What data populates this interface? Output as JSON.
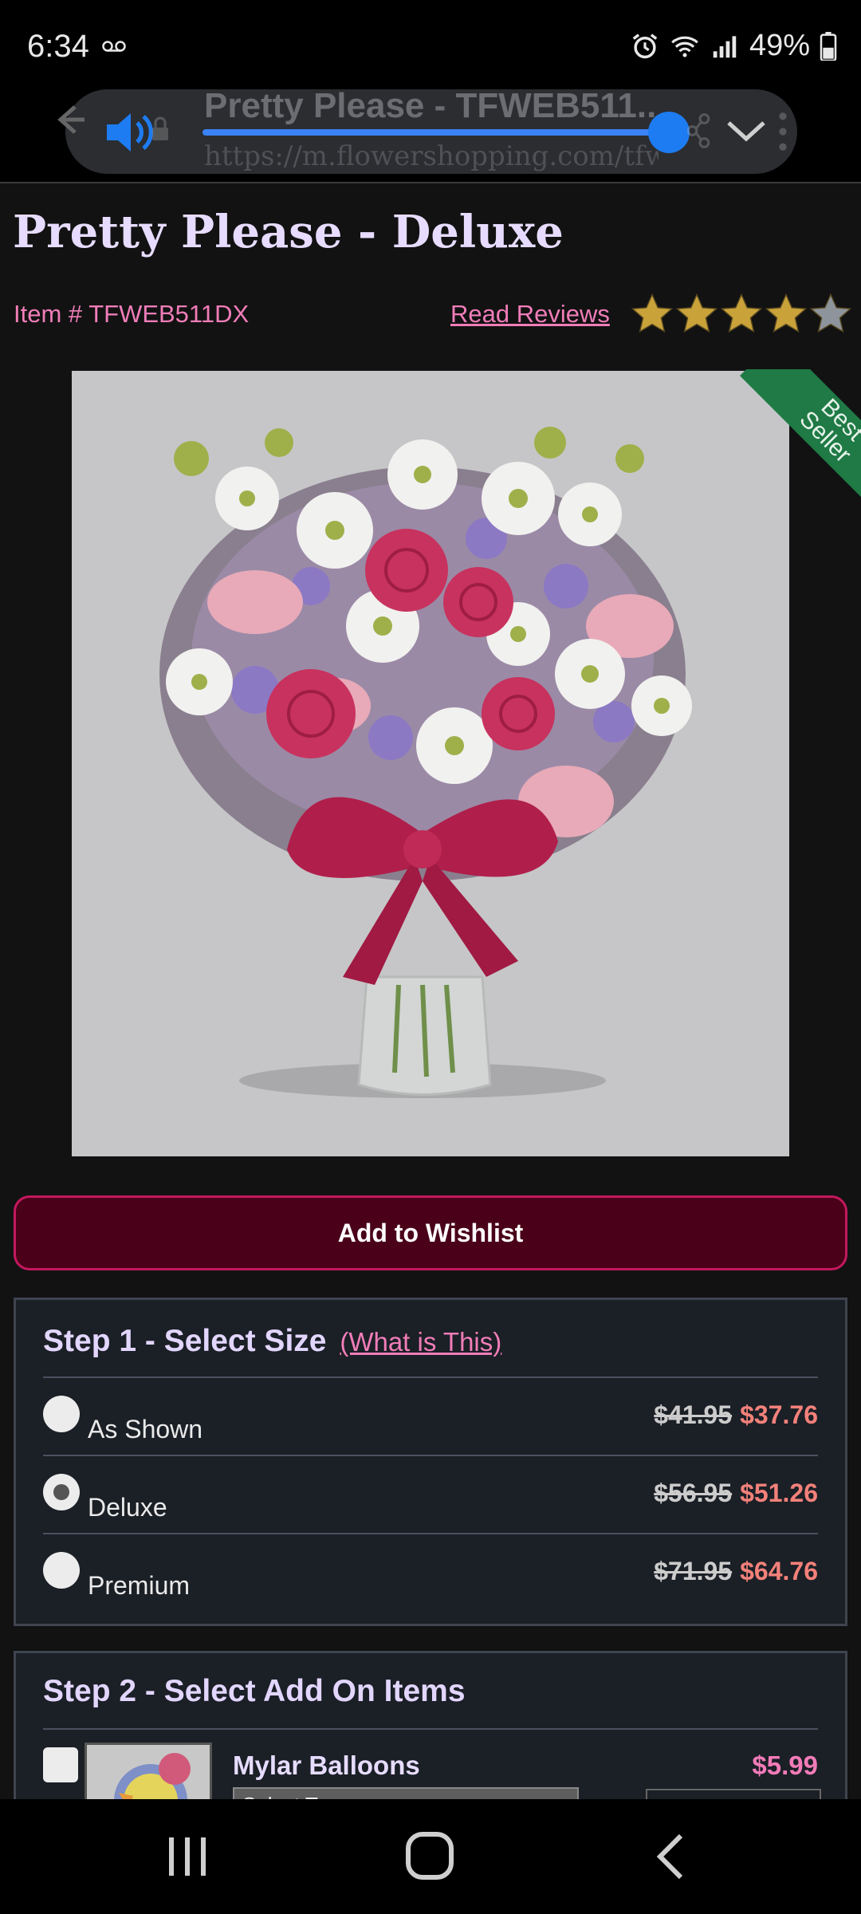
{
  "status": {
    "time": "6:34",
    "battery": "49%"
  },
  "browser": {
    "page_title": "Pretty Please - TFWEB511...",
    "url": "https://m.flowershopping.com/tfwe...",
    "volume_level": 0.95
  },
  "product": {
    "title": "Pretty Please - Deluxe",
    "item_number": "Item # TFWEB511DX",
    "read_reviews": "Read Reviews",
    "rating": 4,
    "rating_max": 5,
    "badge_line1": "Best",
    "badge_line2": "Seller",
    "wishlist_label": "Add to Wishlist"
  },
  "step1": {
    "title": "Step 1 - Select Size",
    "help_link": "(What is This)",
    "options": [
      {
        "label": "As Shown",
        "old_price": "$41.95",
        "new_price": "$37.76",
        "selected": false
      },
      {
        "label": "Deluxe",
        "old_price": "$56.95",
        "new_price": "$51.26",
        "selected": true
      },
      {
        "label": "Premium",
        "old_price": "$71.95",
        "new_price": "$64.76",
        "selected": false
      }
    ]
  },
  "step2": {
    "title": "Step 2 - Select Add On Items",
    "addon": {
      "name": "Mylar Balloons",
      "price": "$5.99",
      "select_placeholder": "Select T..."
    }
  },
  "colors": {
    "accent_pink": "#f07db8",
    "price_red": "#f3817a",
    "wishlist_bg": "#4a0019",
    "badge_green": "#1f7a45",
    "star_gold": "#c9a23a"
  }
}
